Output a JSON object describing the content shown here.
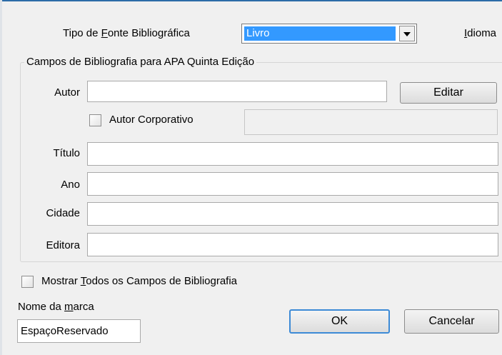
{
  "header": {
    "source_type_label_pre": "Tipo de ",
    "source_type_label_key": "F",
    "source_type_label_post": "onte Bibliográfica",
    "source_type_value": "Livro",
    "language_label_key": "I",
    "language_label_post": "dioma"
  },
  "group": {
    "legend": "Campos de Bibliografia para APA Quinta Edição"
  },
  "fields": {
    "author_label": "Autor",
    "author_value": "",
    "edit_label": "Editar",
    "corporate_author_label": "Autor Corporativo",
    "corporate_author_checked": false,
    "corporate_author_value": "",
    "title_label": "Título",
    "title_value": "",
    "year_label": "Ano",
    "year_value": "",
    "city_label": "Cidade",
    "city_value": "",
    "publisher_label": "Editora",
    "publisher_value": ""
  },
  "footer": {
    "show_all_pre": "Mostrar ",
    "show_all_key": "T",
    "show_all_post": "odos os Campos de Bibliografia",
    "show_all_checked": false,
    "tag_name_label_pre": "Nome da ",
    "tag_name_label_key": "m",
    "tag_name_label_post": "arca",
    "tag_name_value": "EspaçoReservado",
    "ok_label": "OK",
    "cancel_label": "Cancelar"
  },
  "colors": {
    "selection": "#3399ff",
    "default_button_border": "#3c8ad6",
    "window_bg": "#f0f0f0"
  }
}
